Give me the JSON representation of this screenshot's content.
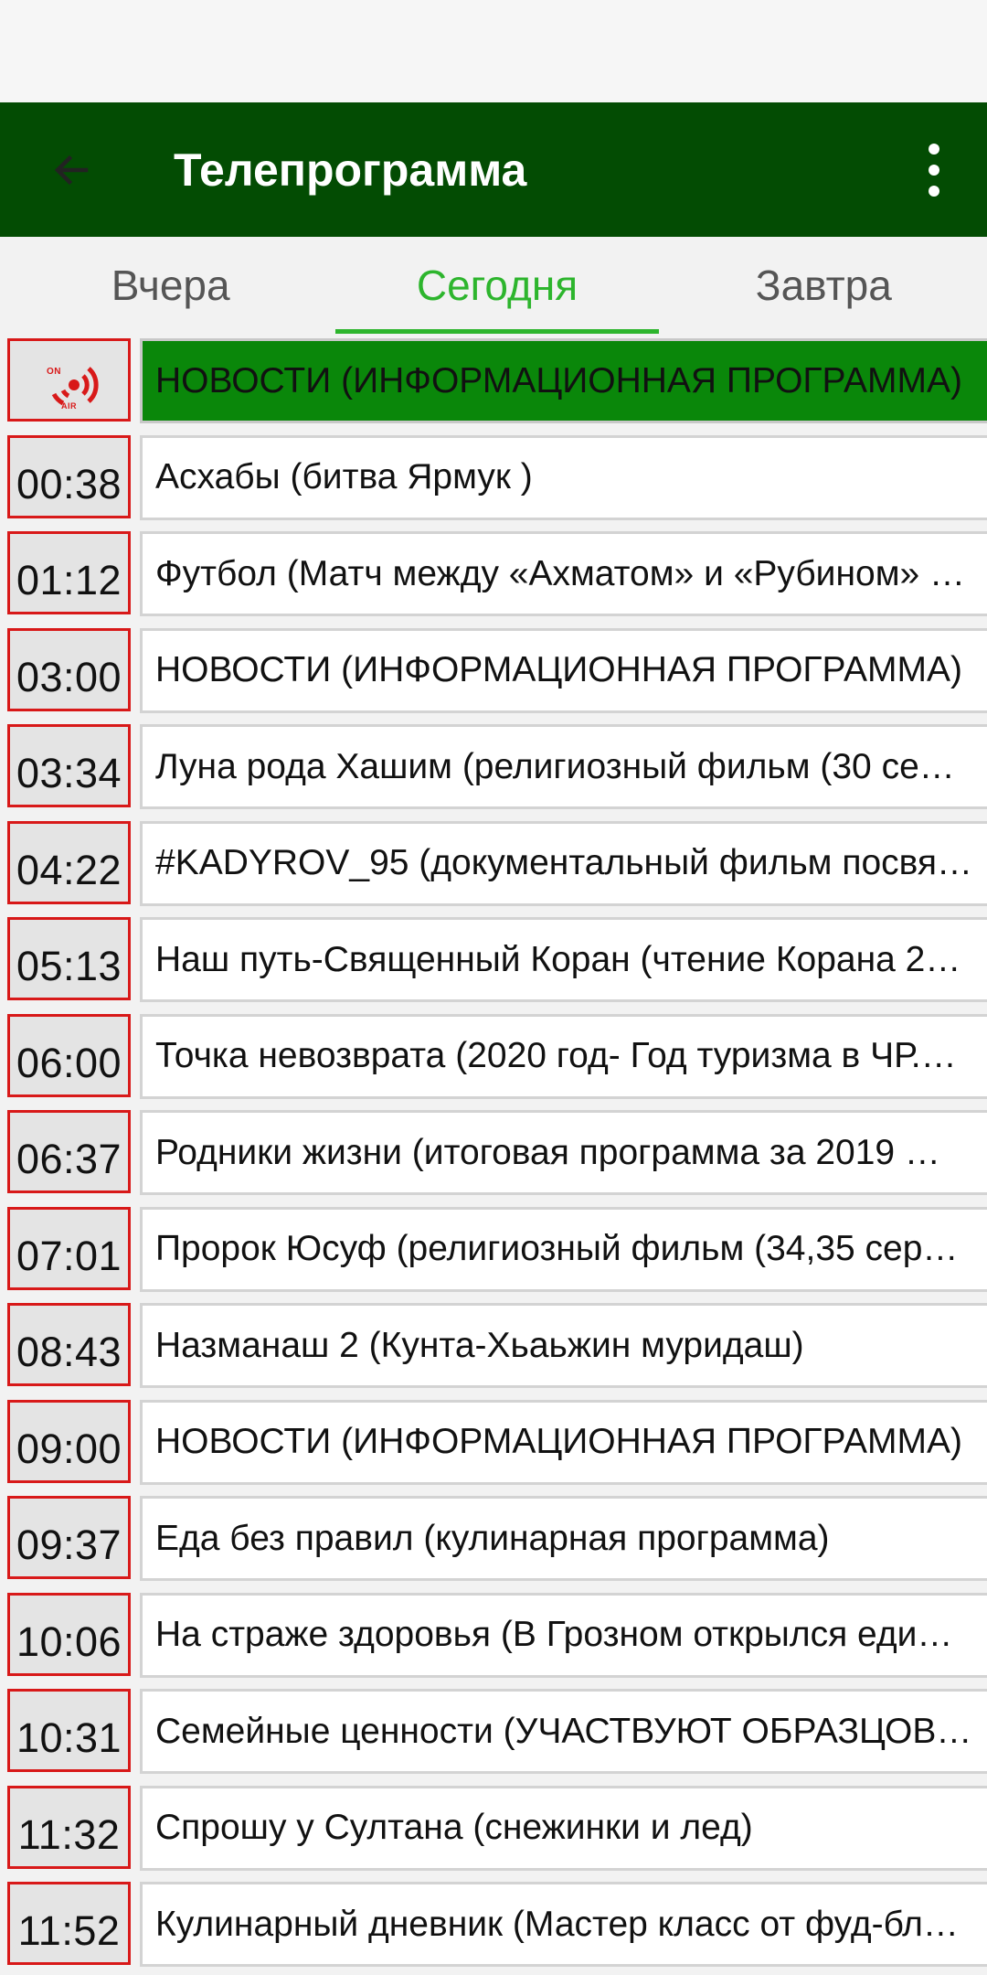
{
  "app_bar": {
    "title": "Телепрограмма",
    "back_icon": "arrow-back-icon",
    "menu_icon": "more-vertical-icon"
  },
  "tabs": [
    {
      "label": "Вчера",
      "active": false
    },
    {
      "label": "Сегодня",
      "active": true
    },
    {
      "label": "Завтра",
      "active": false
    }
  ],
  "colors": {
    "app_bar": "#034c03",
    "active_tab": "#2db52d",
    "live_row": "#0a870a",
    "time_border": "#d81919"
  },
  "on_air": {
    "icon": "on-air-icon",
    "label_top": "ON",
    "label_bottom": "AIR"
  },
  "schedule": [
    {
      "time": "",
      "title": "НОВОСТИ (ИНФОРМАЦИОННАЯ ПРОГРАММА)",
      "live": true
    },
    {
      "time": "00:38",
      "title": "Асхабы (битва Ярмук )"
    },
    {
      "time": "01:12",
      "title": "Футбол (Матч между «Ахматом» и «Рубином» …"
    },
    {
      "time": "03:00",
      "title": "НОВОСТИ (ИНФОРМАЦИОННАЯ ПРОГРАММА)"
    },
    {
      "time": "03:34",
      "title": "Луна рода Хашим (религиозный фильм (30 се…"
    },
    {
      "time": "04:22",
      "title": "#KADYROV_95 (документальный фильм посвя…"
    },
    {
      "time": "05:13",
      "title": "Наш путь-Священный Коран (чтение Корана 2…"
    },
    {
      "time": "06:00",
      "title": "Точка невозврата (2020 год- Год туризма в ЧР.…"
    },
    {
      "time": "06:37",
      "title": "Родники жизни (итоговая программа за 2019 …"
    },
    {
      "time": "07:01",
      "title": "Пророк Юсуф (религиозный фильм (34,35 сер…"
    },
    {
      "time": "08:43",
      "title": "Назманаш 2 (Кунта-Хьаьжин муридаш)"
    },
    {
      "time": "09:00",
      "title": "НОВОСТИ (ИНФОРМАЦИОННАЯ ПРОГРАММА)"
    },
    {
      "time": "09:37",
      "title": "Еда без правил (кулинарная программа)"
    },
    {
      "time": "10:06",
      "title": "На страже здоровья (В Грозном открылся еди…"
    },
    {
      "time": "10:31",
      "title": "Семейные ценности (УЧАСТВУЮТ ОБРАЗЦОВ…"
    },
    {
      "time": "11:32",
      "title": "Спрошу у Султана (снежинки и лед)"
    },
    {
      "time": "11:52",
      "title": "Кулинарный дневник (Мастер класс от фуд-бл…"
    }
  ]
}
